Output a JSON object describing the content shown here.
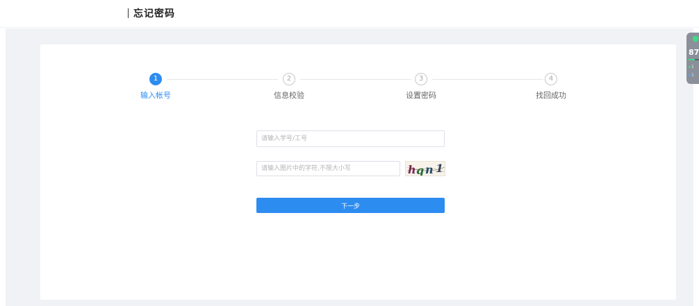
{
  "header": {
    "title": "忘记密码"
  },
  "steps": [
    {
      "number": "1",
      "label": "输入帐号",
      "state": "active"
    },
    {
      "number": "2",
      "label": "信息校验",
      "state": "pending"
    },
    {
      "number": "3",
      "label": "设置密码",
      "state": "pending"
    },
    {
      "number": "4",
      "label": "找回成功",
      "state": "pending"
    }
  ],
  "form": {
    "account_placeholder": "请输入学号/工号",
    "captcha_placeholder": "请输入图片中的字符,不限大小写",
    "captcha_text": "hqn1",
    "next_label": "下一步"
  },
  "widget": {
    "score": "87",
    "line1": "1",
    "line2": "1",
    "progress": 0.6,
    "colors": {
      "shield": "#3ddc84",
      "dot_up": "#3ddc84",
      "dot_down": "#4aa8ff"
    }
  },
  "colors": {
    "accent": "#2d8cf0",
    "background": "#f0f2f5"
  }
}
